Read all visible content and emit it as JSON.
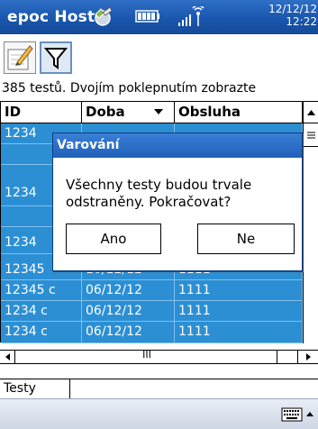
{
  "titlebar": {
    "title": "epoc Host",
    "date": "12/12/12",
    "time": "12:22"
  },
  "toolbar": {
    "buttons": [
      {
        "icon": "edit-icon"
      },
      {
        "icon": "filter-icon",
        "active": true
      }
    ]
  },
  "info_text": "385 testů. Dvojím poklepnutím zobrazte",
  "table": {
    "columns": [
      "ID",
      "Doba",
      "Obsluha"
    ],
    "sort_indicator": "▼",
    "rows": [
      {
        "id": "1234",
        "doba": "",
        "obsluha": ""
      },
      {
        "id": "",
        "doba": "",
        "obsluha": ""
      },
      {
        "id": "1234",
        "doba": "",
        "obsluha": ""
      },
      {
        "id": "",
        "doba": "",
        "obsluha": ""
      },
      {
        "id": "1234",
        "doba": "",
        "obsluha": ""
      },
      {
        "id": "12345",
        "doba": "10/12/12",
        "obsluha": "1111"
      },
      {
        "id": "12345 c",
        "doba": "06/12/12",
        "obsluha": "1111"
      },
      {
        "id": "1234 c",
        "doba": "06/12/12",
        "obsluha": "1111"
      },
      {
        "id": "1234 c",
        "doba": "06/12/12",
        "obsluha": "1111"
      }
    ],
    "row_color": "#2c8fd4",
    "hscroll_label": "III"
  },
  "tabs": [
    "Testy"
  ],
  "dialog": {
    "title": "Varování",
    "message": "Všechny testy budou trvale odstraněny. Pokračovat?",
    "yes_label": "Ano",
    "no_label": "Ne"
  },
  "colors": {
    "titlebar": "#1a56ad",
    "selection": "#2c8fd4",
    "dialog_title": "#1f5fb8"
  }
}
